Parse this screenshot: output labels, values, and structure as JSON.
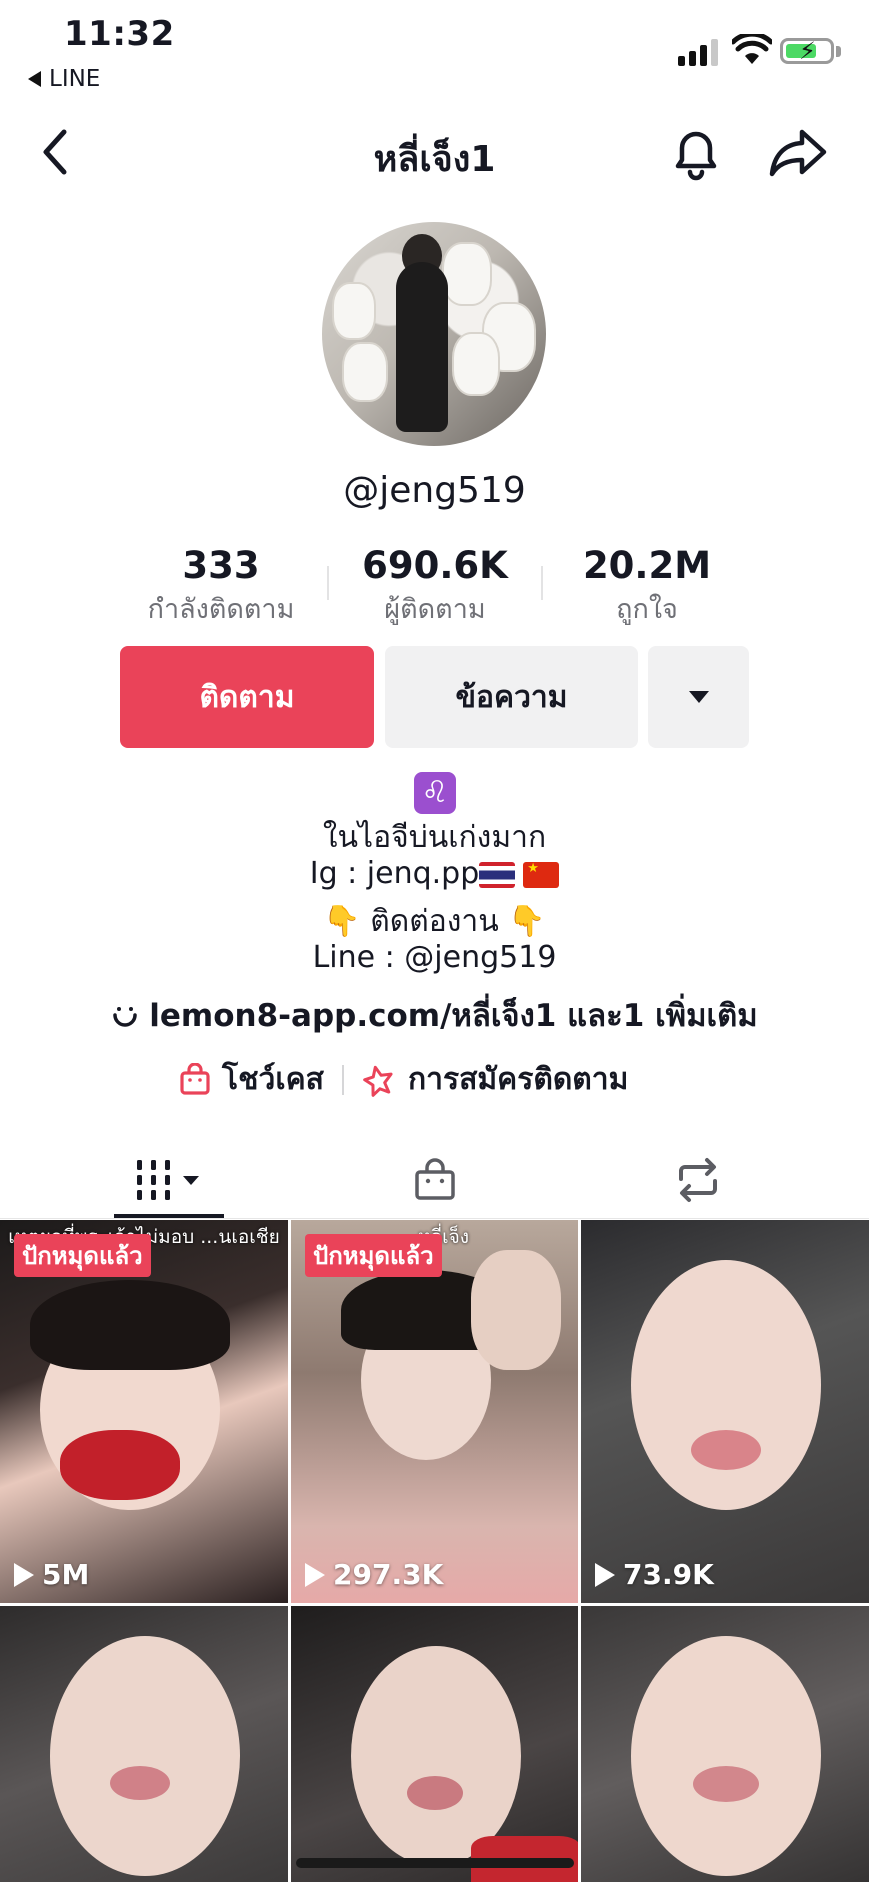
{
  "status_bar": {
    "time": "11:32",
    "back_app": "LINE"
  },
  "header": {
    "title": "หลี่เจ็ง1"
  },
  "profile": {
    "username": "@jeng519",
    "stats": [
      {
        "value": "333",
        "label": "กำลังติดตาม"
      },
      {
        "value": "690.6K",
        "label": "ผู้ติดตาม"
      },
      {
        "value": "20.2M",
        "label": "ถูกใจ"
      }
    ],
    "buttons": {
      "follow": "ติดตาม",
      "message": "ข้อความ"
    },
    "bio": {
      "zodiac": "♌",
      "line1": "ในไอจีบ่นเก่งมาก",
      "line2": "Ig : jenq.pp",
      "line3": "ติดต่องาน",
      "line4": "Line : @jeng519"
    },
    "link": {
      "text": "lemon8-app.com/หลี่เจ็ง1 และ1 เพิ่มเติม"
    },
    "showcase": "โชว์เคส",
    "subscription": "การสมัครติดตาม"
  },
  "tabs": [
    {
      "name": "videos",
      "icon": "grid-icon",
      "active": true
    },
    {
      "name": "shop",
      "icon": "shopping-bag-icon",
      "active": false
    },
    {
      "name": "reposts",
      "icon": "repost-icon",
      "active": false
    }
  ],
  "videos": [
    {
      "views": "5M",
      "pinned_label": "ปักหมุดแล้ว",
      "overlay": "เหตุผลที่พระเจ้าไม่มอบ ...นเอเชีย"
    },
    {
      "views": "297.3K",
      "pinned_label": "ปักหมุดแล้ว",
      "overlay": "...หลี่เจ็ง"
    },
    {
      "views": "73.9K",
      "pinned_label": "",
      "overlay": ""
    },
    {
      "views": "",
      "pinned_label": "",
      "overlay": ""
    },
    {
      "views": "",
      "pinned_label": "",
      "overlay": ""
    },
    {
      "views": "",
      "pinned_label": "",
      "overlay": ""
    }
  ],
  "colors": {
    "accent": "#ea4359",
    "secondary_bg": "#f1f1f2",
    "muted_text": "#6f7076"
  }
}
